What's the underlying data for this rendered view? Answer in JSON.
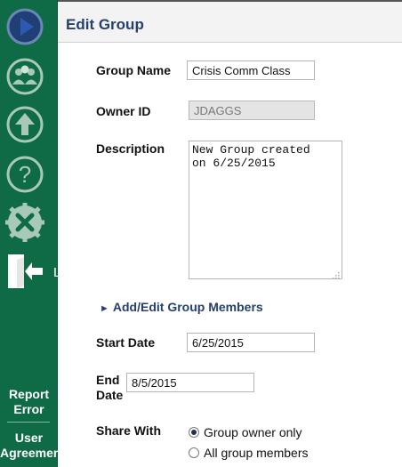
{
  "header": {
    "title": "Edit Group"
  },
  "sidebar": {
    "cut_letter": "L",
    "report_error": "Report\nError",
    "user_agreement": "User\nAgreement"
  },
  "form": {
    "group_name": {
      "label": "Group Name",
      "value": "Crisis Comm Class"
    },
    "owner_id": {
      "label": "Owner ID",
      "value": "JDAGGS"
    },
    "description": {
      "label": "Description",
      "value": "New Group created\non 6/25/2015"
    },
    "members_link": {
      "arrow": "►",
      "label": "Add/Edit Group Members"
    },
    "start_date": {
      "label": "Start Date",
      "value": "6/25/2015"
    },
    "end_date": {
      "label": "End\nDate",
      "value": "8/5/2015"
    },
    "share_with": {
      "label": "Share With",
      "options": [
        {
          "label": "Group owner only",
          "checked": true
        },
        {
          "label": "All group members",
          "checked": false
        }
      ]
    }
  }
}
